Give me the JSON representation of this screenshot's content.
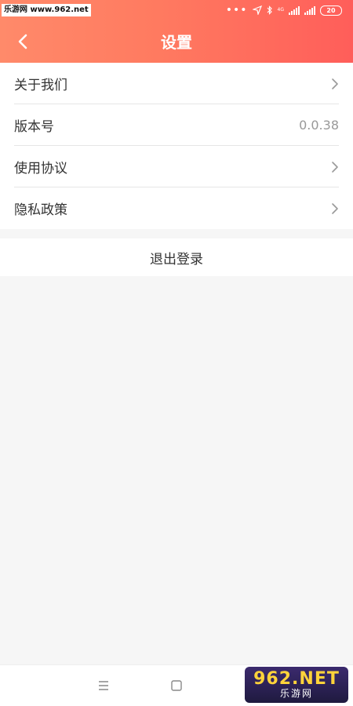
{
  "statusbar": {
    "watermark": "乐游网 www.962.net",
    "network": "4G",
    "battery": "20"
  },
  "header": {
    "title": "设置"
  },
  "settings": {
    "items": [
      {
        "label": "关于我们",
        "value": ""
      },
      {
        "label": "版本号",
        "value": "0.0.38"
      },
      {
        "label": "使用协议",
        "value": ""
      },
      {
        "label": "隐私政策",
        "value": ""
      }
    ]
  },
  "logout": {
    "label": "退出登录"
  },
  "watermark_logo": {
    "top": "962.NET",
    "bottom": "乐游网"
  },
  "colors": {
    "header_start": "#ff8a6a",
    "header_end": "#ff5e5a",
    "background": "#f6f6f6"
  }
}
